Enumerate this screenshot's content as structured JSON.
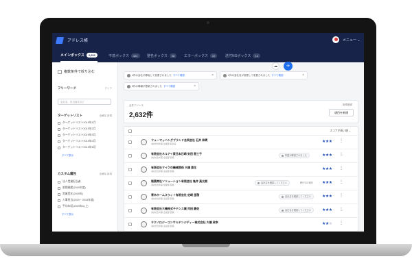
{
  "app": {
    "title": "アドレス帳",
    "menu_label": "メニュー ⌄"
  },
  "tabs": [
    {
      "label": "メインボックス",
      "badge": "2,632",
      "active": true
    },
    {
      "label": "不達ボックス",
      "badge": "324",
      "active": false
    },
    {
      "label": "整名ボックス",
      "badge": "28",
      "active": false
    },
    {
      "label": "エラーボックス",
      "badge": "10",
      "active": false
    },
    {
      "label": "送付NGボックス",
      "badge": "14",
      "active": false
    }
  ],
  "sidebar": {
    "filter_toggle": "複数条件で絞り込む",
    "freeword": {
      "heading": "フリーワード",
      "clear": "クリア",
      "placeholder": "会社名、担当者名など"
    },
    "target_list": {
      "heading": "ターゲットリスト",
      "actions": "全解除  新規",
      "items": [
        "ターゲットリスト2019年1月",
        "ターゲットリスト2019年2月",
        "ターゲットリスト2019年3月",
        "ターゲットリスト2019年4月",
        "ターゲットリスト2019年5月"
      ],
      "more": "すべて表示"
    },
    "custom_attr": {
      "heading": "カスタム属性",
      "actions": "全解除  新規",
      "items": [
        "法人営業担当者",
        "前期業績(2019年度)",
        "営業受注(2019年)",
        "人事担当(2019・2018年度)",
        "平均年収(2019年以上)"
      ],
      "more": "すべて表示"
    }
  },
  "notifications": [
    {
      "text": "4件の会社が移転して変更されました",
      "link": "すべて確認"
    },
    {
      "text": "2件の会社名が変更して変更されました",
      "link": "すべて確認"
    },
    {
      "text": "5件の情報が更新されました",
      "link": "すべて確認"
    }
  ],
  "summary": {
    "label": "全件アドレス",
    "count": "2,632件",
    "new_label": "新規登録",
    "new_button": "項目を新規"
  },
  "list": {
    "sort_label": "スコアが高い順 ⌄",
    "rows": [
      {
        "name": "フューマッハングブランド合同会社 石井 恭実",
        "sub": "(株)総合商事 営業部 取締役",
        "chip": "",
        "status": "",
        "rating": 3
      },
      {
        "name": "有限会社ネルアイ東日本日崎 安田 恵三子",
        "sub": "(株)総合商事 企画部 部長",
        "chip": "所属が確認されました",
        "status": "",
        "rating": 3
      },
      {
        "name": "有限会社マイクの機械関係 大橋 貴生",
        "sub": "(株)総合商事 企画部 部長",
        "chip": "",
        "status": "",
        "rating": 3
      },
      {
        "name": "製薬商社ソリューション有限会社 亀井 真太朗",
        "sub": "(株)総合商事 営業部 部長",
        "chip": "会社名を確認してください",
        "status": "移行中の案件",
        "rating": 3
      },
      {
        "name": "青木ホームスウィト有限会社 佐崎 里雅",
        "sub": "(株)総合商事 企画部 部長",
        "chip": "会社名を確認してください",
        "status": "",
        "rating": 3
      },
      {
        "name": "有限会社大機株式チテンス業 河田 慶佐",
        "sub": "(株)総合商事 企画部 部長",
        "chip": "会社名を確認してください",
        "status": "",
        "rating": 3
      },
      {
        "name": "テクノロジーコンサルテンジディー株式会社 大橋 政幸",
        "sub": "(株)総合商事 企画部 部長",
        "chip": "",
        "status": "",
        "rating": 2
      }
    ]
  },
  "icons": {
    "logo": "logo-icon",
    "add": "plus-icon",
    "sync": "cloud-sync-icon",
    "menu": "kebab-icon",
    "rating": "star-icon"
  },
  "colors": {
    "nav": "#172348",
    "accent": "#1e6ff0",
    "star": "#1d4fb8"
  }
}
